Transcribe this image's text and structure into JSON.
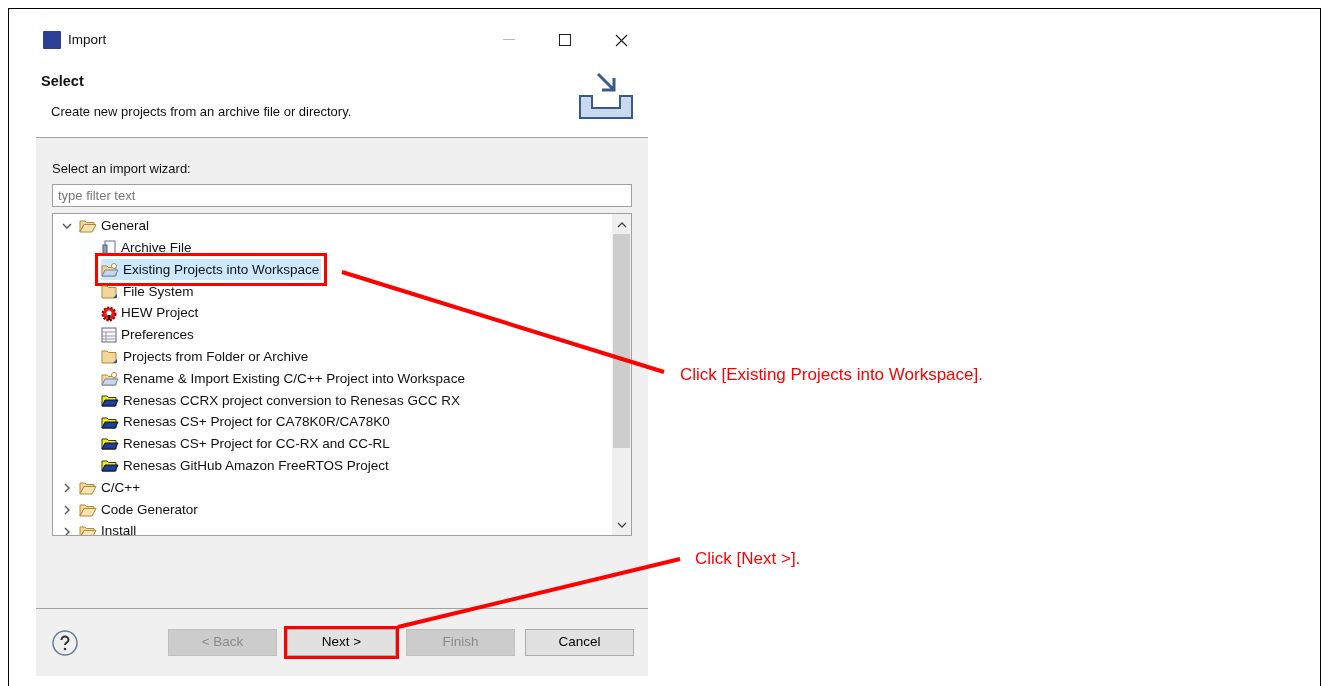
{
  "window": {
    "title": "Import"
  },
  "header": {
    "title": "Select",
    "description": "Create new projects from an archive file or directory."
  },
  "wizard": {
    "label": "Select an import wizard:",
    "filter": {
      "placeholder": "type filter text"
    },
    "tree": [
      {
        "label": "General",
        "kind": "group",
        "expanded": true,
        "selected": false,
        "highlighted": false,
        "children": [
          {
            "label": "Archive File",
            "kind": "archive",
            "selected": false,
            "highlighted": false
          },
          {
            "label": "Existing Projects into Workspace",
            "kind": "project",
            "selected": true,
            "highlighted": true
          },
          {
            "label": "File System",
            "kind": "folder",
            "selected": false,
            "highlighted": false
          },
          {
            "label": "HEW Project",
            "kind": "hew",
            "selected": false,
            "highlighted": false
          },
          {
            "label": "Preferences",
            "kind": "preferences",
            "selected": false,
            "highlighted": false
          },
          {
            "label": "Projects from Folder or Archive",
            "kind": "folder",
            "selected": false,
            "highlighted": false
          },
          {
            "label": "Rename & Import Existing C/C++ Project into Workspace",
            "kind": "project",
            "selected": false,
            "highlighted": false
          },
          {
            "label": "Renesas CCRX project conversion to Renesas GCC RX",
            "kind": "renesas",
            "selected": false,
            "highlighted": false
          },
          {
            "label": "Renesas CS+ Project for CA78K0R/CA78K0",
            "kind": "renesas",
            "selected": false,
            "highlighted": false
          },
          {
            "label": "Renesas CS+ Project for CC-RX and CC-RL",
            "kind": "renesas",
            "selected": false,
            "highlighted": false
          },
          {
            "label": "Renesas GitHub Amazon FreeRTOS Project",
            "kind": "renesas",
            "selected": false,
            "highlighted": false
          }
        ]
      },
      {
        "label": "C/C++",
        "kind": "group",
        "expanded": false,
        "selected": false,
        "highlighted": false
      },
      {
        "label": "Code Generator",
        "kind": "group",
        "expanded": false,
        "selected": false,
        "highlighted": false
      },
      {
        "label": "Install",
        "kind": "group",
        "expanded": false,
        "selected": false,
        "highlighted": false
      }
    ]
  },
  "buttons": [
    {
      "label": "< Back",
      "disabled": true,
      "highlighted": false
    },
    {
      "label": "Next >",
      "disabled": false,
      "highlighted": true
    },
    {
      "label": "Finish",
      "disabled": true,
      "highlighted": false
    },
    {
      "label": "Cancel",
      "disabled": false,
      "highlighted": false
    }
  ],
  "callouts": [
    {
      "text": "Click [Existing Projects into Workspace]."
    },
    {
      "text": "Click [Next >]."
    }
  ]
}
